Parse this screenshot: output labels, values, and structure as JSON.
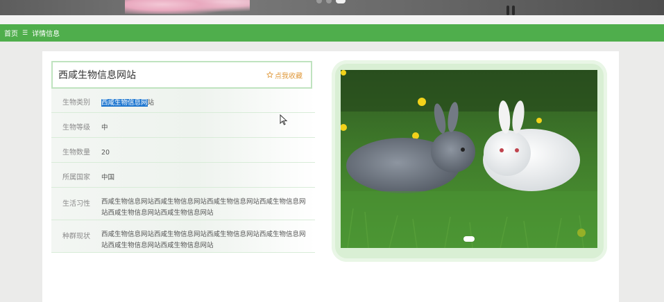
{
  "breadcrumb": {
    "home": "首页",
    "separator": "☰",
    "current": "详情信息"
  },
  "detail": {
    "title": "西咸生物信息网站",
    "favorite_label": "点我收藏",
    "fields": [
      {
        "label": "生物类别",
        "value_selected": "西咸生物信息网",
        "value_rest": "站"
      },
      {
        "label": "生物等级",
        "value": "中"
      },
      {
        "label": "生物数量",
        "value": "20"
      },
      {
        "label": "所属国家",
        "value": "中国"
      },
      {
        "label": "生活习性",
        "value": "西咸生物信息网站西咸生物信息网站西咸生物信息网站西咸生物信息网站西咸生物信息网站西咸生物信息网站"
      },
      {
        "label": "种群现状",
        "value": "西咸生物信息网站西咸生物信息网站西咸生物信息网站西咸生物信息网站西咸生物信息网站西咸生物信息网站"
      }
    ]
  },
  "icons": {
    "favorite": "star-outline-icon",
    "pointer": "mouse-pointer-icon"
  },
  "colors": {
    "accent": "#4fae4c",
    "favorite": "#e09a3e",
    "selection": "#1f77d0"
  }
}
